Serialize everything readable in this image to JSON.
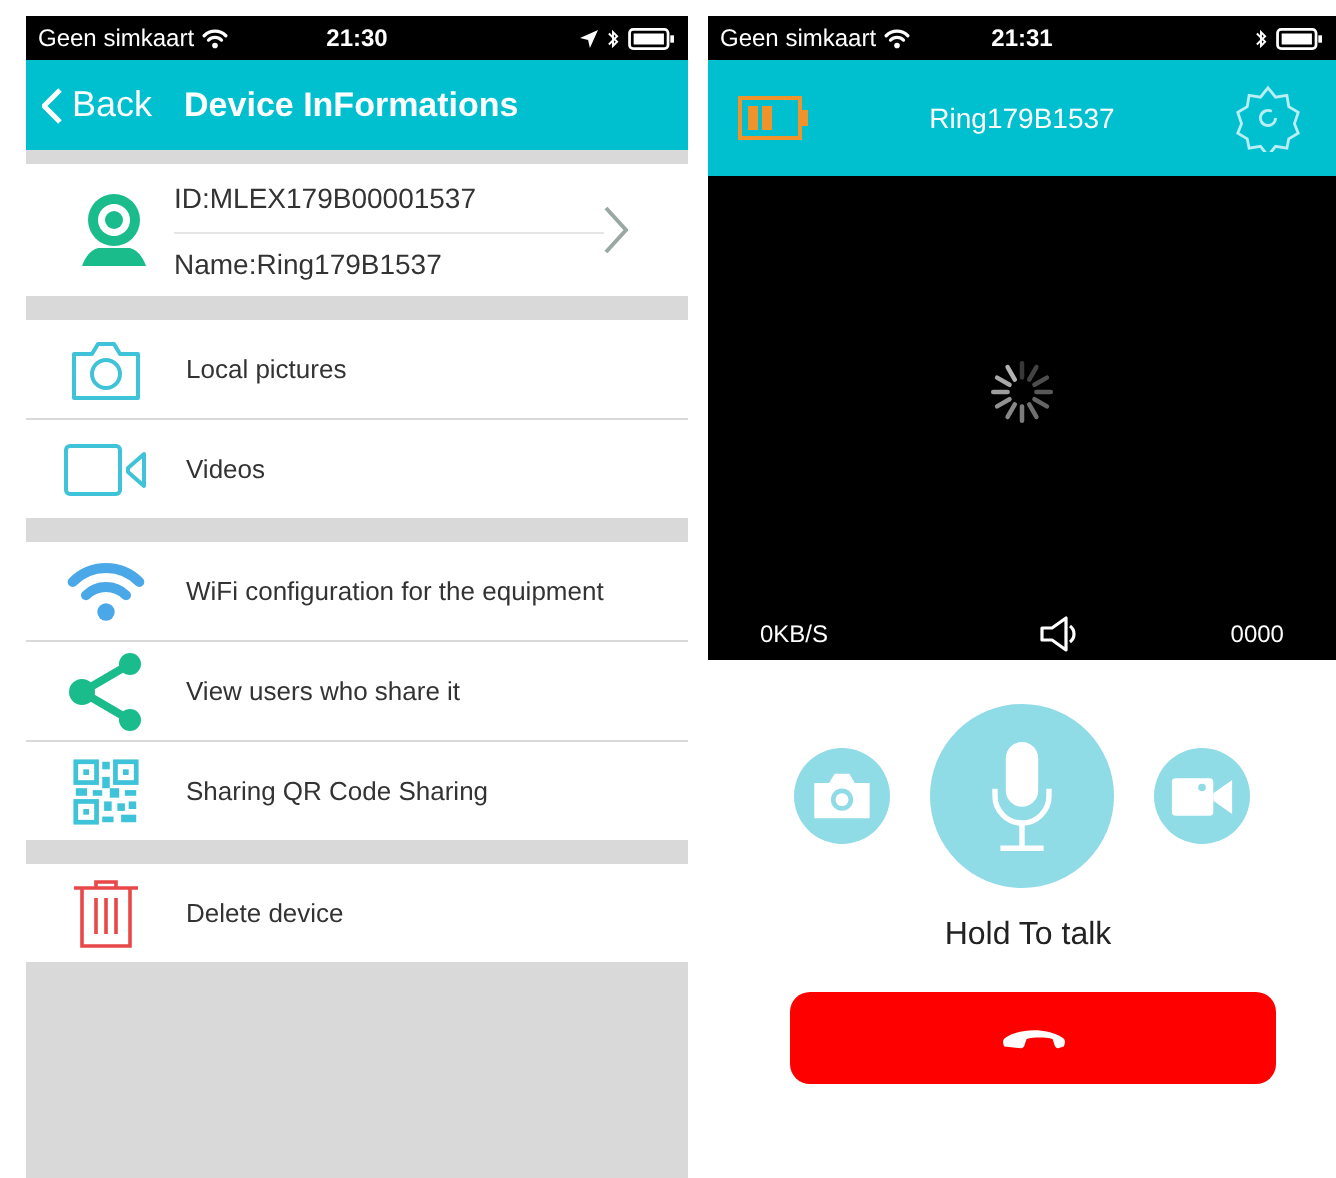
{
  "left_screen": {
    "status_bar": {
      "carrier": "Geen simkaart",
      "time": "21:30"
    },
    "nav_bar": {
      "back": "Back",
      "title": "Device InFormations"
    },
    "device": {
      "id": "ID:MLEX179B00001537",
      "name": "Name:Ring179B1537"
    },
    "menu_groups": [
      [
        {
          "kind": "camera",
          "label": "Local pictures"
        },
        {
          "kind": "video",
          "label": "Videos"
        }
      ],
      [
        {
          "kind": "wifi",
          "label": "WiFi configuration for the equipment"
        },
        {
          "kind": "share",
          "label": "View users who share it"
        },
        {
          "kind": "qr",
          "label": "Sharing QR Code Sharing"
        }
      ],
      [
        {
          "kind": "trash",
          "label": "Delete device"
        }
      ]
    ]
  },
  "right_screen": {
    "status_bar": {
      "carrier": "Geen simkaart",
      "time": "21:31"
    },
    "header": {
      "title": "Ring179B1537"
    },
    "video": {
      "speed": "0KB/S",
      "counter": "0000"
    },
    "hint": "Hold To talk"
  }
}
